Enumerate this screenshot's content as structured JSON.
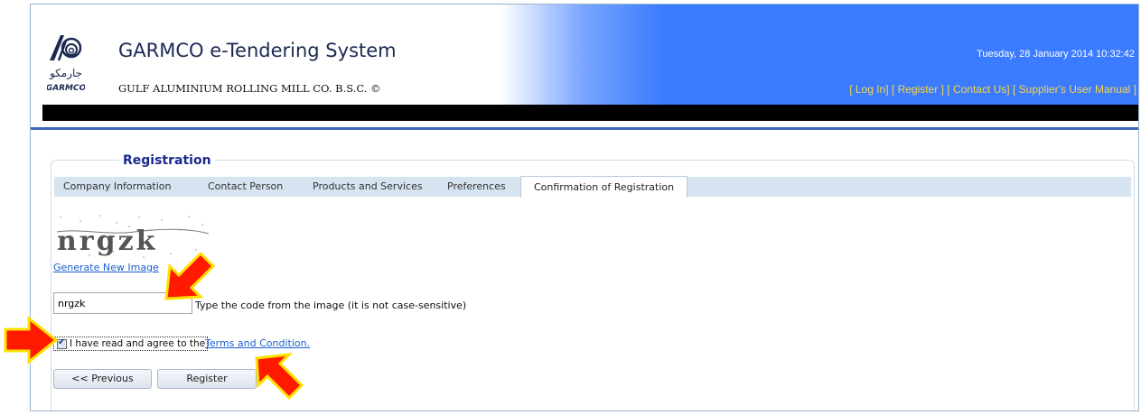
{
  "header": {
    "app_title": "GARMCO e-Tendering System",
    "company_name": "GULF ALUMINIUM ROLLING MILL CO. B.S.C. ©",
    "logo_text_arabic": "جارمكو",
    "logo_text": "GARMCO",
    "datetime": "Tuesday, 28 January 2014 10:32:42",
    "links": [
      {
        "label": "[ Log In]"
      },
      {
        "label": "[ Register ]"
      },
      {
        "label": "[ Contact Us]"
      },
      {
        "label": "[ Supplier's User Manual ]"
      }
    ]
  },
  "registration": {
    "title": "Registration",
    "tabs": [
      {
        "label": "Company Information",
        "active": false
      },
      {
        "label": "Contact Person",
        "active": false
      },
      {
        "label": "Products and Services",
        "active": false
      },
      {
        "label": "Preferences",
        "active": false
      },
      {
        "label": "Confirmation of Registration",
        "active": true
      }
    ],
    "captcha_text": "nrgzk",
    "generate_link": "Generate New Image",
    "code_value": "nrgzk",
    "code_hint": "Type the code from the image (it is not case-sensitive)",
    "agree_checked": true,
    "agree_label": "I have read and agree to the",
    "terms_link": "Terms and Condition.",
    "previous_button": "<< Previous",
    "register_button": "Register"
  },
  "colors": {
    "header_blue": "#3b7bff",
    "link_yellow": "#f5d547",
    "title_navy": "#1a2a8c",
    "tab_bar": "#d6e3f1",
    "arrow_red": "#ff1a00",
    "arrow_outline": "#ffe000"
  }
}
